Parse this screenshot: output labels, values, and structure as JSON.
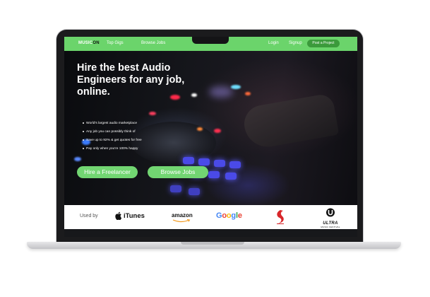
{
  "nav": {
    "logo_main": "MUSIC",
    "logo_accent": "ON",
    "links": [
      "Top Gigs",
      "Browse Jobs"
    ],
    "login": "Login",
    "signup": "Signup",
    "post_project": "Post a Project"
  },
  "hero": {
    "headline": "Hire the best Audio Engineers for any job, online.",
    "bullets": [
      "World's largest audio marketplace",
      "Any job you can possibly think of",
      "Save up to 92% & get quotes for free",
      "Pay only when you're 100% happy"
    ],
    "cta_primary": "Hire a Freelancer",
    "cta_secondary": "Browse Jobs"
  },
  "logos": {
    "used_by": "Used by",
    "itunes": "iTunes",
    "amazon": "amazon",
    "google": [
      "G",
      "o",
      "o",
      "g",
      "l",
      "e"
    ],
    "ultra": "ULTRA",
    "ultra_sub": "MUSIC FESTIVAL"
  },
  "colors": {
    "accent_green": "#6bd46b",
    "cta_green": "#72d672",
    "google_blue": "#4285f4",
    "google_red": "#ea4335",
    "google_yellow": "#fbbc05",
    "google_green": "#34a853",
    "sony_red": "#d8262a"
  }
}
